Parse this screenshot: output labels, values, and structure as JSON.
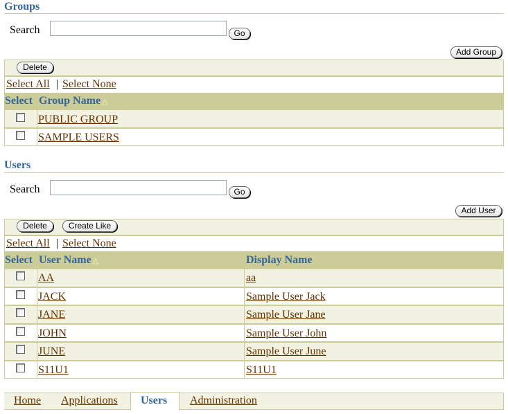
{
  "groups": {
    "title": "Groups",
    "search_label": "Search",
    "search_value": "",
    "go_label": "Go",
    "add_label": "Add Group",
    "delete_label": "Delete",
    "select_all": "Select All",
    "select_none": "Select None",
    "separator": "|",
    "columns": {
      "select": "Select",
      "name": "Group Name"
    },
    "sort_icon": "triangle-up-icon",
    "rows": [
      {
        "name": "PUBLIC GROUP"
      },
      {
        "name": "SAMPLE USERS"
      }
    ]
  },
  "users": {
    "title": "Users",
    "search_label": "Search",
    "search_value": "",
    "go_label": "Go",
    "add_label": "Add User",
    "delete_label": "Delete",
    "create_like_label": "Create Like",
    "select_all": "Select All",
    "select_none": "Select None",
    "separator": "|",
    "columns": {
      "select": "Select",
      "name": "User Name",
      "display": "Display Name"
    },
    "sort_icon": "triangle-up-icon",
    "rows": [
      {
        "name": "AA",
        "display": "aa"
      },
      {
        "name": "JACK",
        "display": "Sample User Jack"
      },
      {
        "name": "JANE",
        "display": "Sample User Jane"
      },
      {
        "name": "JOHN",
        "display": "Sample User John"
      },
      {
        "name": "JUNE",
        "display": "Sample User June"
      },
      {
        "name": "S11U1",
        "display": "S11U1"
      }
    ]
  },
  "tabs": [
    {
      "label": "Home",
      "active": false
    },
    {
      "label": "Applications",
      "active": false
    },
    {
      "label": "Users",
      "active": true
    },
    {
      "label": "Administration",
      "active": false
    }
  ],
  "colors": {
    "header_text": "#336699",
    "link": "#663300",
    "table_header_bg": "#cccc99",
    "band_bg": "#f2f2e2"
  }
}
